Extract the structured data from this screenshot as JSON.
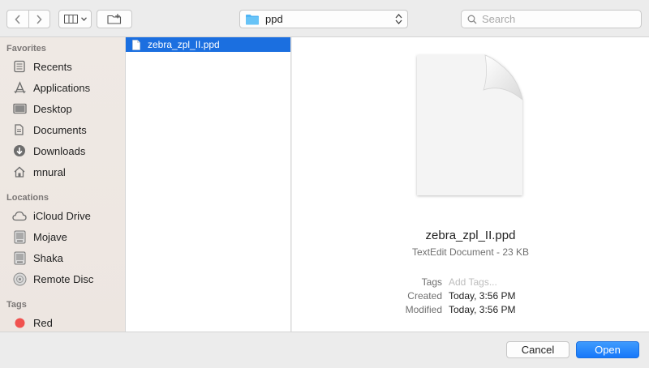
{
  "toolbar": {
    "back_icon": "chevron-left-icon",
    "forward_icon": "chevron-right-icon",
    "view_icon": "column-view-icon",
    "new_folder_icon": "new-folder-icon",
    "location": "ppd",
    "search_placeholder": "Search"
  },
  "sidebar": {
    "favorites_heading": "Favorites",
    "favorites": [
      {
        "label": "Recents",
        "icon": "recents-icon"
      },
      {
        "label": "Applications",
        "icon": "applications-icon"
      },
      {
        "label": "Desktop",
        "icon": "desktop-icon"
      },
      {
        "label": "Documents",
        "icon": "documents-icon"
      },
      {
        "label": "Downloads",
        "icon": "downloads-icon"
      },
      {
        "label": "mnural",
        "icon": "home-icon"
      }
    ],
    "locations_heading": "Locations",
    "locations": [
      {
        "label": "iCloud Drive",
        "icon": "cloud-icon"
      },
      {
        "label": "Mojave",
        "icon": "disk-icon"
      },
      {
        "label": "Shaka",
        "icon": "disk-icon"
      },
      {
        "label": "Remote Disc",
        "icon": "remote-disc-icon"
      }
    ],
    "tags_heading": "Tags",
    "tags": [
      {
        "label": "Red",
        "color": "#f0524f"
      }
    ]
  },
  "files": [
    {
      "name": "zebra_zpl_II.ppd",
      "selected": true
    }
  ],
  "preview": {
    "name": "zebra_zpl_II.ppd",
    "kind": "TextEdit Document - 23 KB",
    "tags_label": "Tags",
    "tags_placeholder": "Add Tags...",
    "created_label": "Created",
    "created_value": "Today, 3:56 PM",
    "modified_label": "Modified",
    "modified_value": "Today, 3:56 PM"
  },
  "footer": {
    "cancel_label": "Cancel",
    "open_label": "Open"
  },
  "colors": {
    "selection": "#1b6fe0",
    "primary_button": "#1678fa",
    "folder": "#4fb4f4"
  }
}
